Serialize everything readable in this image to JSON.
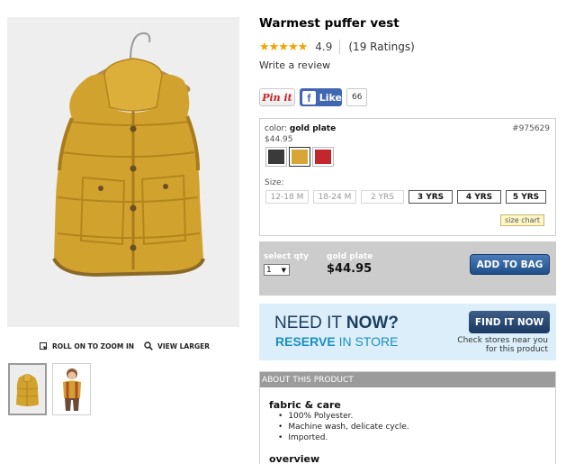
{
  "product": {
    "title": "Warmest puffer vest",
    "stars": "★★★★★",
    "rating": "4.9",
    "ratings_count": "(19 Ratings)",
    "write_review": "Write a review"
  },
  "social": {
    "pinit_label": "Pin it",
    "like_label": "Like",
    "like_count": "66"
  },
  "options": {
    "color_prefix": "color:",
    "color_name": "gold plate",
    "item_number": "#975629",
    "price": "$44.95",
    "swatches": [
      {
        "name": "charcoal",
        "color": "#3a3a3a"
      },
      {
        "name": "gold plate",
        "color": "#d8a636"
      },
      {
        "name": "red",
        "color": "#c4262e"
      }
    ],
    "size_label": "Size:",
    "sizes": [
      {
        "label": "12-18 M",
        "available": false
      },
      {
        "label": "18-24 M",
        "available": false
      },
      {
        "label": "2 YRS",
        "available": false
      },
      {
        "label": "3 YRS",
        "available": true
      },
      {
        "label": "4 YRS",
        "available": true
      },
      {
        "label": "5 YRS",
        "available": true
      }
    ],
    "size_chart": "size chart"
  },
  "bag": {
    "qty_label": "select qty",
    "qty_value": "1",
    "color_name": "gold plate",
    "price": "$44.95",
    "add_button": "ADD TO BAG"
  },
  "reserve": {
    "need_it": "NEED IT",
    "now": "NOW?",
    "reserve": "RESERVE",
    "in_store": "IN STORE",
    "find_button": "FIND IT NOW",
    "check_stores": "Check stores near you for this product"
  },
  "gallery": {
    "roll_zoom": "ROLL ON TO ZOOM IN",
    "view_larger": "VIEW LARGER"
  },
  "about": {
    "header": "ABOUT THIS PRODUCT",
    "fabric_title": "fabric & care",
    "bullets": [
      "100% Polyester.",
      "Machine wash, delicate cycle.",
      "Imported."
    ],
    "overview_title": "overview"
  },
  "colors": {
    "vest": "#d6a531",
    "add_button": "#2d5f9c",
    "reserve_bg": "#dbeefa",
    "star": "#f0a400"
  }
}
